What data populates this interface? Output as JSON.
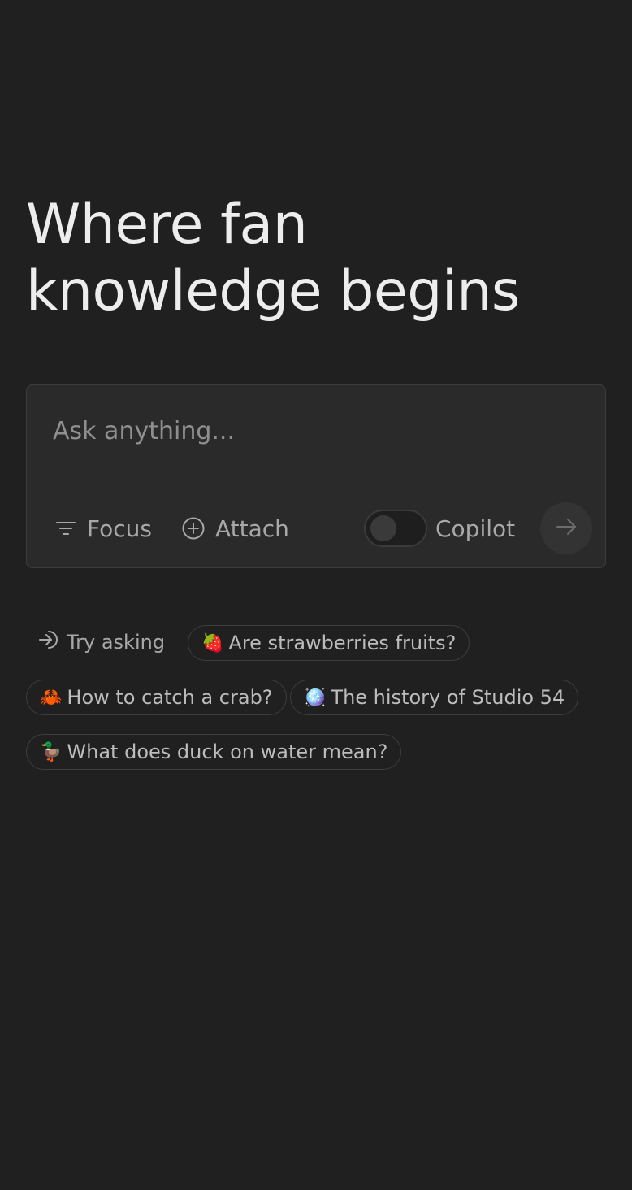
{
  "headline": {
    "line1": "Where fan",
    "line2": "knowledge begins"
  },
  "search": {
    "placeholder": "Ask anything...",
    "value": ""
  },
  "toolbar": {
    "focus_label": "Focus",
    "focus_icon": "filter-lines-icon",
    "attach_label": "Attach",
    "attach_icon": "plus-circle-icon",
    "copilot_label": "Copilot",
    "copilot_enabled": false,
    "send_icon": "arrow-right-icon"
  },
  "suggestions": {
    "label": "Try asking",
    "label_icon": "arrow-into-icon",
    "items": [
      {
        "emoji": "🍓",
        "text": "Are strawberries fruits?"
      },
      {
        "emoji": "🦀",
        "text": "How to catch a crab?"
      },
      {
        "emoji": "🪩",
        "text": "The history of Studio 54"
      },
      {
        "emoji": "🦆",
        "text": "What does duck on water mean?"
      }
    ]
  },
  "colors": {
    "background": "#202020",
    "panel": "#2a2a2a",
    "border": "#3d3d3d",
    "text_primary": "#ededed",
    "text_muted": "#a8a8a8"
  }
}
